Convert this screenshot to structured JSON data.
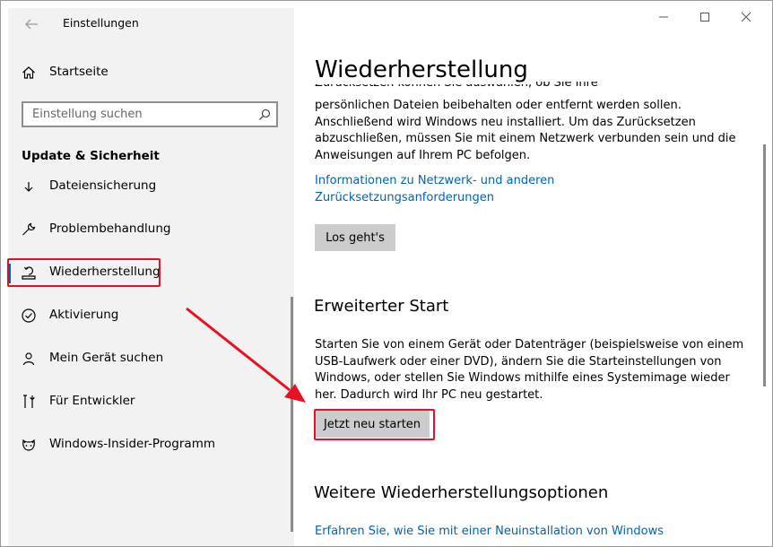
{
  "window": {
    "app_title": "Einstellungen"
  },
  "sidebar": {
    "home_label": "Startseite",
    "search_placeholder": "Einstellung suchen",
    "section_title": "Update & Sicherheit",
    "items": [
      {
        "label": "Dateiensicherung",
        "icon": "backup-icon"
      },
      {
        "label": "Problembehandlung",
        "icon": "wrench-icon"
      },
      {
        "label": "Wiederherstellung",
        "icon": "recovery-icon",
        "selected": true
      },
      {
        "label": "Aktivierung",
        "icon": "check-circle-icon"
      },
      {
        "label": "Mein Gerät suchen",
        "icon": "person-pin-icon"
      },
      {
        "label": "Für Entwickler",
        "icon": "developer-tools-icon"
      },
      {
        "label": "Windows-Insider-Programm",
        "icon": "insider-cat-icon"
      }
    ]
  },
  "main": {
    "title": "Wiederherstellung",
    "reset": {
      "text_partial": "Zurücksetzen können Sie auswählen, ob Sie Ihre",
      "text_lines": [
        "persönlichen Dateien beibehalten oder entfernt werden sollen.",
        "Anschließend wird Windows neu installiert. Um das Zurücksetzen",
        "abzuschließen, müssen Sie mit einem Netzwerk verbunden sein und die",
        "Anweisungen auf Ihrem PC befolgen."
      ],
      "link_lines": [
        "Informationen zu Netzwerk- und anderen",
        "Zurücksetzungsanforderungen"
      ],
      "button": "Los geht's"
    },
    "advanced": {
      "title": "Erweiterter Start",
      "text_lines": [
        "Starten Sie von einem Gerät oder Datenträger (beispielsweise von einem",
        "USB-Laufwerk oder einer DVD), ändern Sie die Starteinstellungen von",
        "Windows, oder stellen Sie Windows mithilfe eines Systemimage wieder",
        "her. Dadurch wird Ihr PC neu gestartet."
      ],
      "button": "Jetzt neu starten"
    },
    "more": {
      "title": "Weitere Wiederherstellungsoptionen",
      "link": "Erfahren Sie, wie Sie mit einer Neuinstallation von Windows"
    }
  },
  "colors": {
    "accent": "#0063b1",
    "highlight": "#e81123",
    "sidebar_bg": "#f2f2f2",
    "button_bg": "#cccccc"
  }
}
